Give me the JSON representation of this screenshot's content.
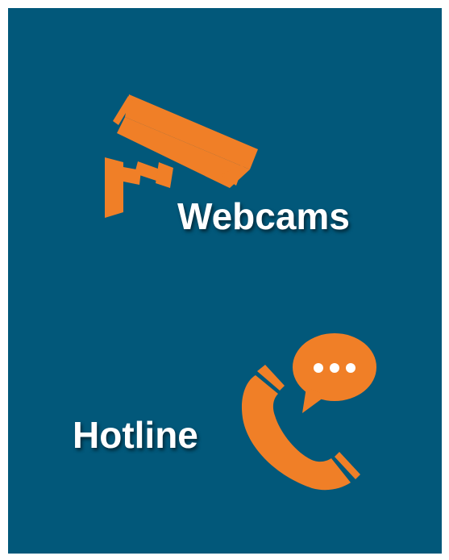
{
  "colors": {
    "page_background": "#ffffff",
    "panel_background": "#02587a",
    "accent": "#f07f27",
    "label_text": "#ffffff"
  },
  "webcams": {
    "label": "Webcams",
    "icon": "security-camera-icon"
  },
  "hotline": {
    "label": "Hotline",
    "icon": "phone-chat-icon"
  }
}
